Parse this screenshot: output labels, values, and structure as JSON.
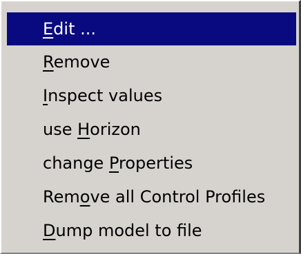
{
  "context_menu": {
    "colors": {
      "background": "#d6d3ce",
      "selected_background": "#0a0a80",
      "selected_text": "#ffffff",
      "text": "#000000"
    },
    "selected_index": 0,
    "items": [
      {
        "before": "",
        "mnemonic": "E",
        "after": "dit ..."
      },
      {
        "before": "",
        "mnemonic": "R",
        "after": "emove"
      },
      {
        "before": "",
        "mnemonic": "I",
        "after": "nspect values"
      },
      {
        "before": "use ",
        "mnemonic": "H",
        "after": "orizon"
      },
      {
        "before": "change ",
        "mnemonic": "P",
        "after": "roperties"
      },
      {
        "before": "Rem",
        "mnemonic": "o",
        "after": "ve all Control Profiles"
      },
      {
        "before": "",
        "mnemonic": "D",
        "after": "ump model to file"
      }
    ]
  }
}
